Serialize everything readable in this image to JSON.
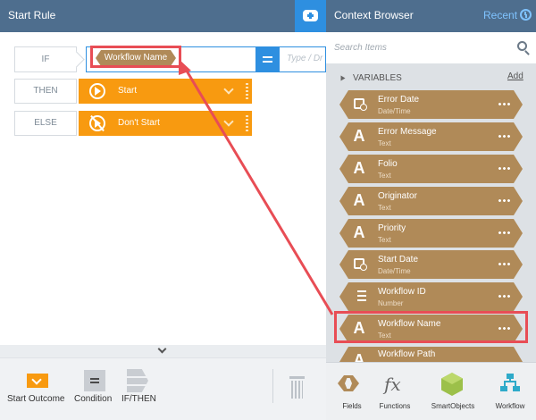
{
  "left_panel": {
    "title": "Start Rule",
    "add_button_icon": "add-rule-icon",
    "rows": {
      "if_label": "IF",
      "then_label": "THEN",
      "else_label": "ELSE"
    },
    "condition_chip": "Workflow Name",
    "condition_placeholder": "Type / Dr",
    "outcomes": [
      {
        "label": "Start",
        "icon": "play-icon"
      },
      {
        "label": "Don't Start",
        "icon": "no-play-icon"
      }
    ],
    "toolbox": {
      "start_outcome": "Start Outcome",
      "condition": "Condition",
      "if_then": "IF/THEN"
    }
  },
  "context_browser": {
    "title": "Context Browser",
    "recent_label": "Recent",
    "search_placeholder": "Search Items",
    "variables_title": "VARIABLES",
    "add_label": "Add",
    "variables": [
      {
        "name": "Error Date",
        "type": "Date/Time",
        "icon": "date-time-icon"
      },
      {
        "name": "Error Message",
        "type": "Text",
        "icon": "text-icon"
      },
      {
        "name": "Folio",
        "type": "Text",
        "icon": "text-icon"
      },
      {
        "name": "Originator",
        "type": "Text",
        "icon": "text-icon"
      },
      {
        "name": "Priority",
        "type": "Text",
        "icon": "text-icon"
      },
      {
        "name": "Start Date",
        "type": "Date/Time",
        "icon": "date-time-icon"
      },
      {
        "name": "Workflow ID",
        "type": "Number",
        "icon": "number-icon"
      },
      {
        "name": "Workflow Name",
        "type": "Text",
        "icon": "text-icon"
      },
      {
        "name": "Workflow Path",
        "type": "",
        "icon": "text-icon"
      }
    ],
    "tabs": [
      {
        "label": "Fields",
        "icon": "fields-icon"
      },
      {
        "label": "Functions",
        "icon": "functions-icon"
      },
      {
        "label": "SmartObjects",
        "icon": "smartobjects-icon"
      },
      {
        "label": "Workflow",
        "icon": "workflow-icon"
      }
    ]
  },
  "colors": {
    "header": "#4e6e8e",
    "accent_blue": "#2e8fe0",
    "outcome_orange": "#f89a10",
    "variable_brown": "#b08a58",
    "highlight_red": "#e84d55"
  }
}
